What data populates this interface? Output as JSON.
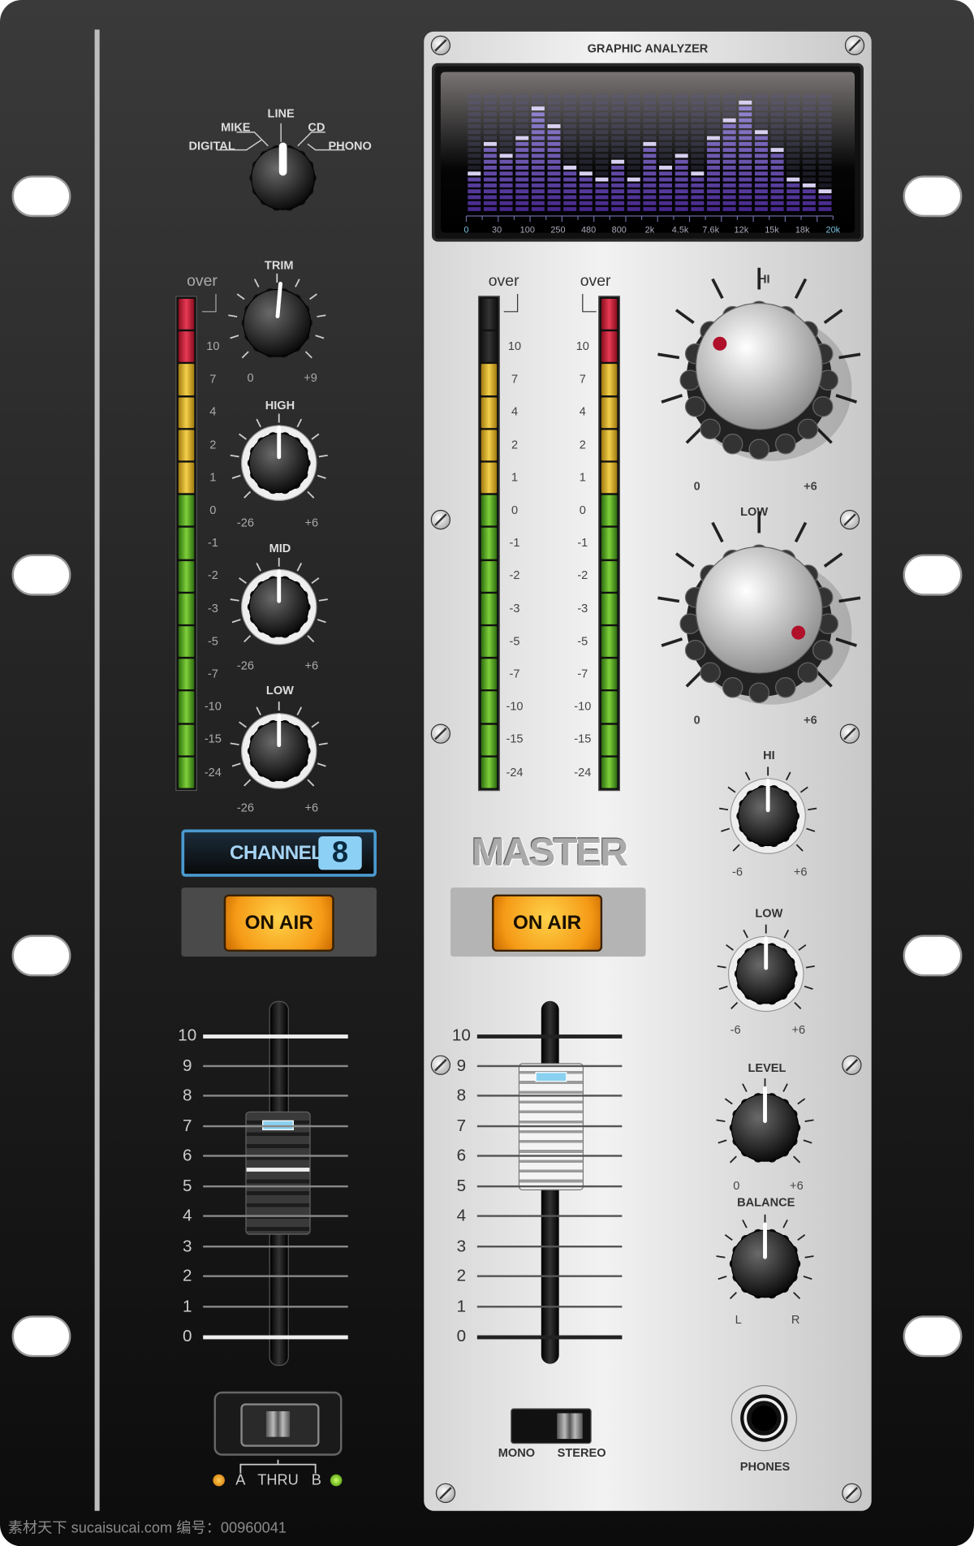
{
  "channel": {
    "input_selector": {
      "labels": [
        "DIGITAL",
        "MIKE",
        "LINE",
        "CD",
        "PHONO"
      ],
      "selected": "LINE"
    },
    "trim": {
      "label": "TRIM",
      "min": "0",
      "max": "+9"
    },
    "high": {
      "label": "HIGH",
      "min": "-26",
      "max": "+6"
    },
    "mid": {
      "label": "MID",
      "min": "-26",
      "max": "+6"
    },
    "low": {
      "label": "LOW",
      "min": "-26",
      "max": "+6"
    },
    "meter": {
      "over_label": "over",
      "scale": [
        "10",
        "7",
        "4",
        "2",
        "1",
        "0",
        "-1",
        "-2",
        "-3",
        "-5",
        "-7",
        "-10",
        "-15",
        "-24"
      ],
      "segments": [
        "red",
        "red",
        "yellow",
        "yellow",
        "yellow",
        "yellow",
        "green",
        "green",
        "green",
        "green",
        "green",
        "green",
        "green",
        "green",
        "green"
      ]
    },
    "display": {
      "text": "CHANNEL",
      "number": "8",
      "color": "#4a9ad0"
    },
    "on_air": "ON AIR",
    "fader": {
      "scale": [
        "10",
        "9",
        "8",
        "7",
        "6",
        "5",
        "4",
        "3",
        "2",
        "1",
        "0"
      ],
      "value": 6
    },
    "crossfader_assign": {
      "a": "A",
      "thru": "THRU",
      "b": "B"
    }
  },
  "master": {
    "analyzer": {
      "title": "GRAPHIC ANALYZER",
      "freq_labels": [
        "0",
        "30",
        "100",
        "250",
        "480",
        "800",
        "2k",
        "4.5k",
        "7.6k",
        "12k",
        "15k",
        "18k",
        "20k"
      ],
      "levels": [
        7,
        12,
        10,
        13,
        18,
        15,
        8,
        7,
        6,
        9,
        6,
        12,
        8,
        10,
        7,
        13,
        16,
        19,
        14,
        11,
        6,
        5,
        4
      ],
      "max_level": 20
    },
    "meter_left": {
      "over_label": "over",
      "scale": [
        "10",
        "7",
        "4",
        "2",
        "1",
        "0",
        "-1",
        "-2",
        "-3",
        "-5",
        "-7",
        "-10",
        "-15",
        "-24"
      ],
      "segments": [
        "off",
        "off",
        "yellow",
        "yellow",
        "yellow",
        "yellow",
        "green",
        "green",
        "green",
        "green",
        "green",
        "green",
        "green",
        "green",
        "green"
      ]
    },
    "meter_right": {
      "over_label": "over",
      "scale": [
        "10",
        "7",
        "4",
        "2",
        "1",
        "0",
        "-1",
        "-2",
        "-3",
        "-5",
        "-7",
        "-10",
        "-15",
        "-24"
      ],
      "segments": [
        "red",
        "red",
        "yellow",
        "yellow",
        "yellow",
        "yellow",
        "green",
        "green",
        "green",
        "green",
        "green",
        "green",
        "green",
        "green",
        "green"
      ]
    },
    "big_hi": {
      "label": "HI",
      "min": "0",
      "max": "+6"
    },
    "big_low": {
      "label": "LOW",
      "min": "0",
      "max": "+6"
    },
    "title": "MASTER",
    "on_air": "ON AIR",
    "fader": {
      "scale": [
        "10",
        "9",
        "8",
        "7",
        "6",
        "5",
        "4",
        "3",
        "2",
        "1",
        "0"
      ],
      "value": 9
    },
    "mono_stereo": {
      "mono": "MONO",
      "stereo": "STEREO",
      "selected": "STEREO"
    },
    "hi": {
      "label": "HI",
      "min": "-6",
      "max": "+6"
    },
    "low": {
      "label": "LOW",
      "min": "-6",
      "max": "+6"
    },
    "level": {
      "label": "LEVEL",
      "min": "0",
      "max": "+6"
    },
    "balance": {
      "label": "BALANCE",
      "min": "L",
      "max": "R"
    },
    "phones": "PHONES"
  },
  "watermark": "素材天下 sucaisucai.com  编号：00960041",
  "colors": {
    "accent_orange": "#f59a16",
    "led_red": "#e83a55",
    "led_yellow": "#f3cf4a",
    "led_green": "#7ed03a",
    "analyzer_purple": "#5a3fa0"
  }
}
